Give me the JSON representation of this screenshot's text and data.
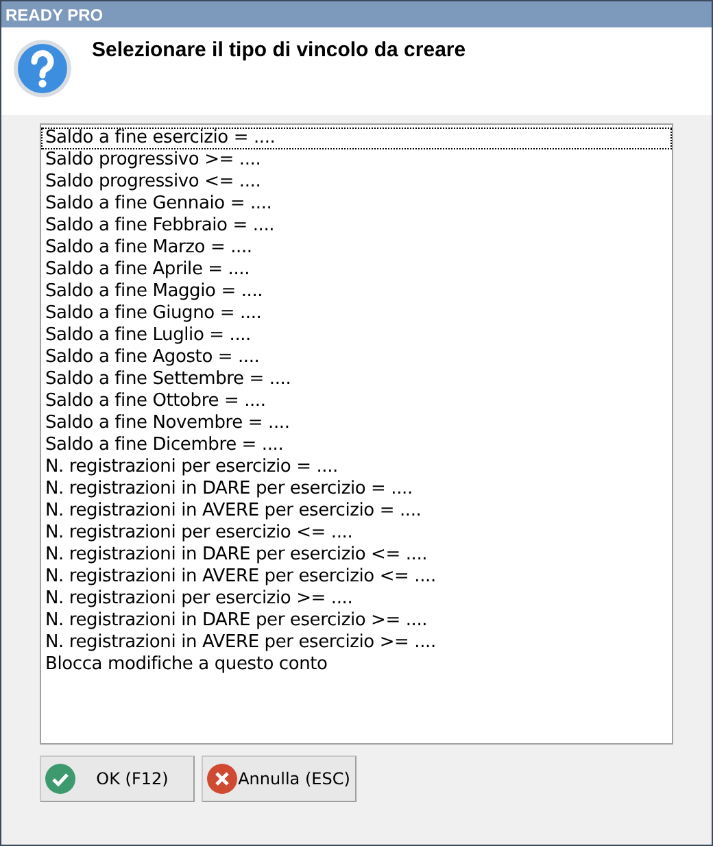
{
  "window": {
    "title": "READY PRO"
  },
  "header": {
    "message": "Selezionare il tipo di vincolo da creare"
  },
  "list": {
    "items": [
      {
        "label": "Saldo a fine esercizio = ....",
        "focused": true
      },
      {
        "label": "Saldo progressivo >= ....",
        "focused": false
      },
      {
        "label": "Saldo progressivo <= ....",
        "focused": false
      },
      {
        "label": "Saldo a fine Gennaio = ....",
        "focused": false
      },
      {
        "label": "Saldo a fine Febbraio = ....",
        "focused": false
      },
      {
        "label": "Saldo a fine Marzo = ....",
        "focused": false
      },
      {
        "label": "Saldo a fine Aprile = ....",
        "focused": false
      },
      {
        "label": "Saldo a fine Maggio = ....",
        "focused": false
      },
      {
        "label": "Saldo a fine Giugno = ....",
        "focused": false
      },
      {
        "label": "Saldo a fine Luglio = ....",
        "focused": false
      },
      {
        "label": "Saldo a fine Agosto = ....",
        "focused": false
      },
      {
        "label": "Saldo a fine Settembre = ....",
        "focused": false
      },
      {
        "label": "Saldo a fine Ottobre = ....",
        "focused": false
      },
      {
        "label": "Saldo a fine Novembre = ....",
        "focused": false
      },
      {
        "label": "Saldo a fine Dicembre = ....",
        "focused": false
      },
      {
        "label": "N. registrazioni per esercizio = ....",
        "focused": false
      },
      {
        "label": "N. registrazioni in DARE per esercizio = ....",
        "focused": false
      },
      {
        "label": "N. registrazioni in AVERE per esercizio = ....",
        "focused": false
      },
      {
        "label": "N. registrazioni per esercizio <= ....",
        "focused": false
      },
      {
        "label": "N. registrazioni in DARE per esercizio <= ....",
        "focused": false
      },
      {
        "label": "N. registrazioni in AVERE per esercizio <= ....",
        "focused": false
      },
      {
        "label": "N. registrazioni per esercizio >= ....",
        "focused": false
      },
      {
        "label": "N. registrazioni in DARE per esercizio >= ....",
        "focused": false
      },
      {
        "label": "N. registrazioni in AVERE per esercizio >= ....",
        "focused": false
      },
      {
        "label": "Blocca modifiche a questo conto",
        "focused": false
      }
    ]
  },
  "buttons": [
    {
      "label": "OK (F12)",
      "kind": "ok"
    },
    {
      "label": "Annulla (ESC)",
      "kind": "cancel"
    }
  ]
}
